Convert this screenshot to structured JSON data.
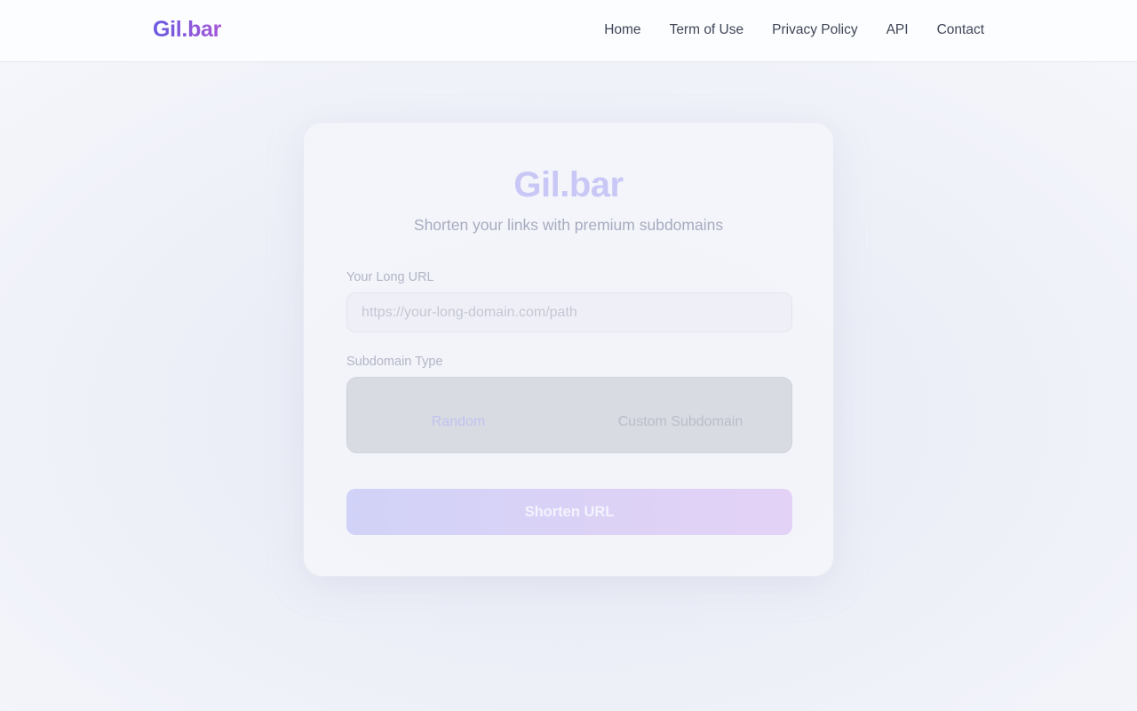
{
  "header": {
    "logo": "Gil.bar",
    "nav": [
      "Home",
      "Term of Use",
      "Privacy Policy",
      "API",
      "Contact"
    ]
  },
  "card": {
    "title": "Gil.bar",
    "subtitle": "Shorten your links with premium subdomains",
    "url_label": "Your Long URL",
    "url_placeholder": "https://your-long-domain.com/path",
    "url_value": "",
    "type_label": "Subdomain Type",
    "type_options": [
      "Random",
      "Custom Subdomain"
    ],
    "type_selected": "Random",
    "submit_label": "Shorten URL"
  },
  "colors": {
    "brand_start": "#6a5ae0",
    "brand_end": "#a457d6",
    "button_start": "#d1d2f7",
    "button_end": "#e3d2f6"
  }
}
